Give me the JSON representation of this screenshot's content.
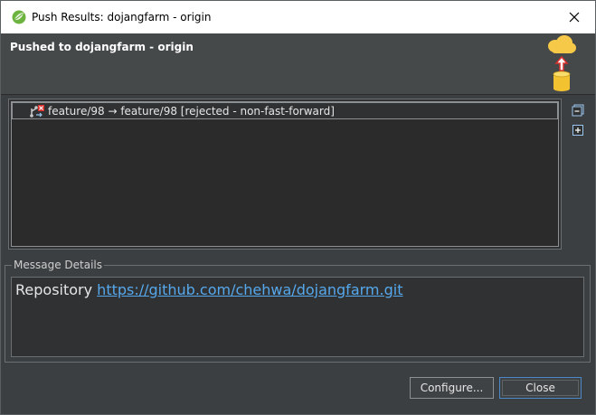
{
  "window": {
    "title": "Push Results: dojangfarm - origin",
    "icons": {
      "app": "eclipse-spring-icon",
      "close": "close-icon"
    }
  },
  "header": {
    "title": "Pushed to dojangfarm - origin",
    "icon": "cloud-push-icon"
  },
  "results": {
    "rows": [
      {
        "label": "feature/98 → feature/98 [rejected - non-fast-forward]",
        "icon": "branch-rejected-icon"
      }
    ],
    "side_buttons": [
      "collapse-all-icon",
      "expand-all-icon"
    ]
  },
  "message_details": {
    "legend": "Message Details",
    "prefix": "Repository ",
    "link": "https://github.com/chehwa/dojangfarm.git"
  },
  "buttons": {
    "configure": "Configure...",
    "close": "Close"
  },
  "colors": {
    "background": "#3c3f41",
    "link": "#56a8ec",
    "focus_border": "#4a88c7",
    "title_bar": "#ffffff"
  }
}
